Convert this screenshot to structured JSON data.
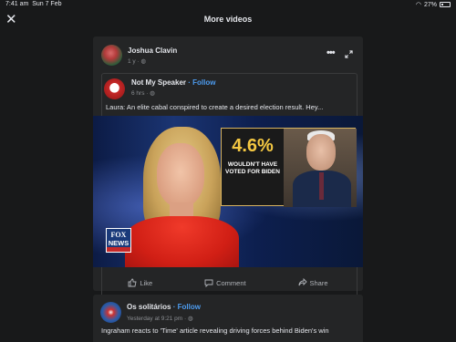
{
  "status_bar": {
    "time": "7:41 am",
    "date": "Sun 7 Feb",
    "battery": "27%"
  },
  "header": {
    "title": "More videos",
    "close_icon": "close-icon"
  },
  "post": {
    "author": "Joshua Clavin",
    "time": "1 y",
    "shared": {
      "author": "Not My Speaker",
      "follow": "Follow",
      "time": "6 hrs",
      "text": "Laura: An elite cabal conspired to create a desired election result. Hey..."
    },
    "video": {
      "inset_percent": "4.6%",
      "inset_caption": "WOULDN'T HAVE VOTED FOR BIDEN",
      "logo_line1": "FOX",
      "logo_line2": "NEWS",
      "logo_line3": "channel"
    },
    "actions": {
      "like": "Like",
      "comment": "Comment",
      "share": "Share"
    }
  },
  "next_post": {
    "author": "Os solitários",
    "follow": "Follow",
    "time": "Yesterday at 9:21 pm",
    "text": "Ingraham reacts to 'Time' article revealing driving forces behind Biden's win"
  },
  "colors": {
    "background": "#18191a",
    "card": "#242526",
    "link": "#4d9cf0",
    "muted": "#8a8d91"
  }
}
